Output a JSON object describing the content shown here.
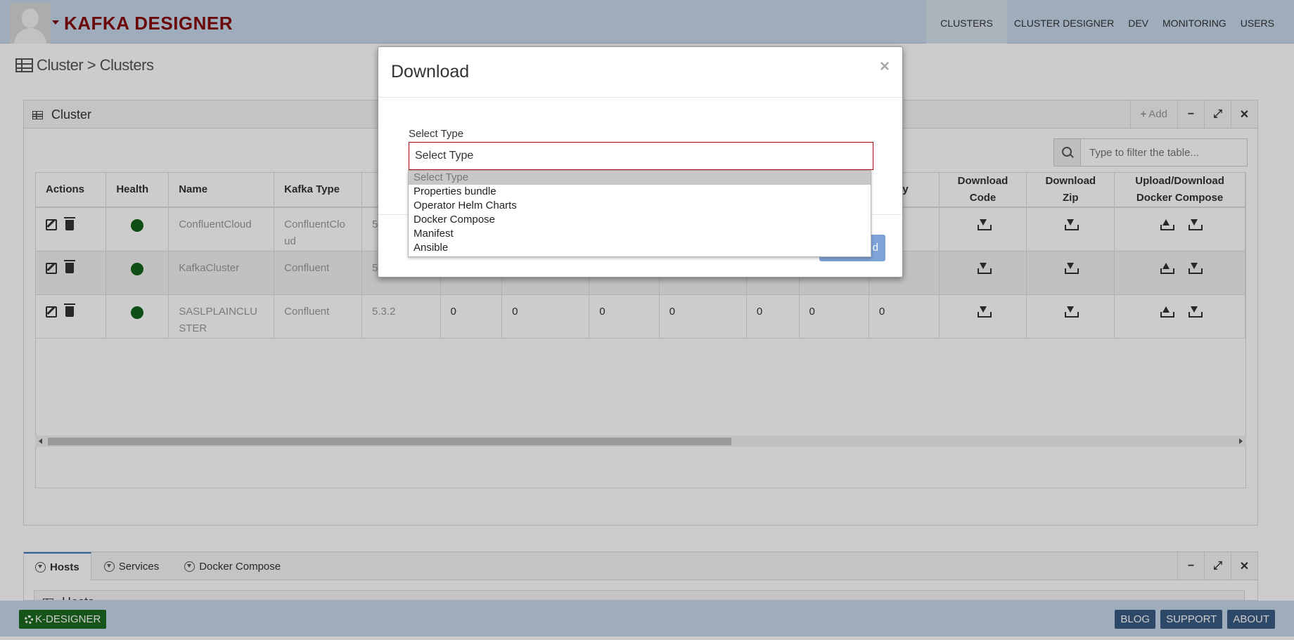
{
  "navbar": {
    "brand": "KAFKA DESIGNER",
    "items": [
      "CLUSTERS",
      "CLUSTER DESIGNER",
      "DEV",
      "MONITORING",
      "USERS"
    ]
  },
  "breadcrumb": {
    "text": "Cluster > Clusters"
  },
  "cluster_panel": {
    "title": "Cluster",
    "add_label": "Add",
    "search_placeholder": "Type to filter the table...",
    "columns": {
      "actions": "Actions",
      "health": "Health",
      "name": "Name",
      "kafka_type": "Kafka Type",
      "proxy": "Proxy",
      "download_code_1": "Download",
      "download_code_2": "Code",
      "download_zip": "Download Zip",
      "upload_download_1": "Upload/Download",
      "upload_download_2": "Docker Compose"
    },
    "rows": [
      {
        "name_1": "ConfluentCloud",
        "name_2": "",
        "type_1": "ConfluentClo",
        "type_2": "ud",
        "version": "5",
        "counts": [
          "",
          "",
          "",
          "",
          "",
          "",
          ""
        ]
      },
      {
        "name_1": "KafkaCluster",
        "name_2": "",
        "type_1": "Confluent",
        "type_2": "",
        "version": "5",
        "counts": [
          "",
          "",
          "",
          "",
          "",
          "",
          ""
        ]
      },
      {
        "name_1": "SASLPLAINCLU",
        "name_2": "STER",
        "type_1": "Confluent",
        "type_2": "",
        "version": "5.3.2",
        "counts": [
          "0",
          "0",
          "0",
          "0",
          "0",
          "0",
          "0"
        ]
      }
    ]
  },
  "bottom_panel": {
    "tabs": [
      "Hosts",
      "Services",
      "Docker Compose"
    ],
    "sub_title": "Hosts"
  },
  "footer": {
    "brand_button": "K-DESIGNER",
    "buttons": [
      "BLOG",
      "SUPPORT",
      "ABOUT"
    ]
  },
  "modal": {
    "title": "Download",
    "close": "×",
    "field_label": "Select Type",
    "select_value": "Select Type",
    "options": [
      "Select Type",
      "Properties bundle",
      "Operator Helm Charts",
      "Docker Compose",
      "Manifest",
      "Ansible"
    ],
    "button_label": "d"
  }
}
